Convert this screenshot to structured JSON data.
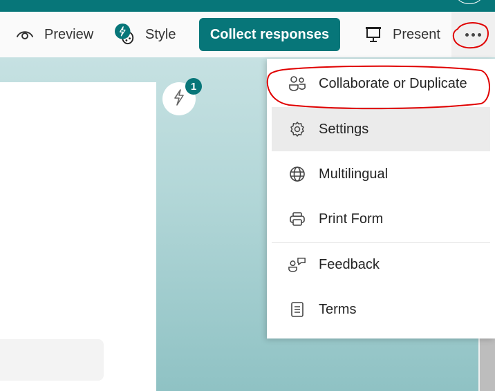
{
  "toolbar": {
    "preview_label": "Preview",
    "style_label": "Style",
    "collect_label": "Collect responses",
    "present_label": "Present",
    "more_icon": "more-horizontal-icon"
  },
  "canvas": {
    "quick_badge_count": "1",
    "quick_icon": "lightning-icon"
  },
  "menu": {
    "items": [
      {
        "label": "Collaborate or Duplicate",
        "icon": "people-icon"
      },
      {
        "label": "Settings",
        "icon": "gear-icon"
      },
      {
        "label": "Multilingual",
        "icon": "globe-icon"
      },
      {
        "label": "Print Form",
        "icon": "printer-icon"
      },
      {
        "label": "Feedback",
        "icon": "person-feedback-icon"
      },
      {
        "label": "Terms",
        "icon": "document-icon"
      }
    ]
  },
  "colors": {
    "brand": "#077679",
    "annotation": "#e00000",
    "menu_hover": "#ebebeb"
  }
}
